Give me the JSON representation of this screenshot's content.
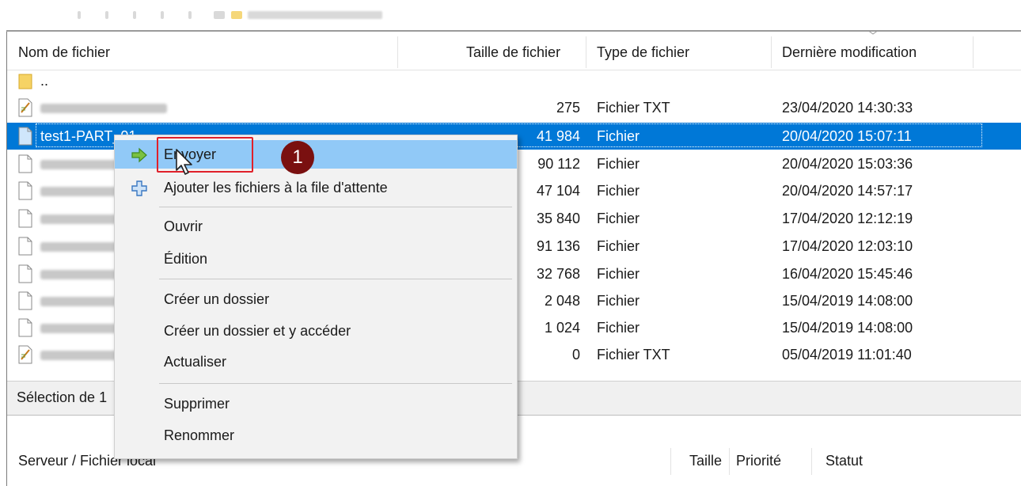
{
  "file_list": {
    "columns": [
      "Nom de fichier",
      "Taille de fichier",
      "Type de fichier",
      "Dernière modification"
    ],
    "rows": [
      {
        "name": "..",
        "size": "",
        "type": "",
        "date": "",
        "icon": "folder-icon"
      },
      {
        "name": "",
        "size": "275",
        "type": "Fichier TXT",
        "date": "23/04/2020 14:30:33",
        "icon": "text-file-icon"
      },
      {
        "name": "test1-PART_01",
        "size": "41 984",
        "type": "Fichier",
        "date": "20/04/2020 15:07:11",
        "icon": "file-icon",
        "selected": true
      },
      {
        "name": "",
        "size": "90 112",
        "type": "Fichier",
        "date": "20/04/2020 15:03:36",
        "icon": "file-icon"
      },
      {
        "name": "",
        "size": "47 104",
        "type": "Fichier",
        "date": "20/04/2020 14:57:17",
        "icon": "file-icon"
      },
      {
        "name": "",
        "size": "35 840",
        "type": "Fichier",
        "date": "17/04/2020 12:12:19",
        "icon": "file-icon"
      },
      {
        "name": "",
        "size": "91 136",
        "type": "Fichier",
        "date": "17/04/2020 12:03:10",
        "icon": "file-icon"
      },
      {
        "name": "",
        "size": "32 768",
        "type": "Fichier",
        "date": "16/04/2020 15:45:46",
        "icon": "file-icon"
      },
      {
        "name": "",
        "size": "2 048",
        "type": "Fichier",
        "date": "15/04/2019 14:08:00",
        "icon": "file-icon"
      },
      {
        "name": "",
        "size": "1 024",
        "type": "Fichier",
        "date": "15/04/2019 14:08:00",
        "icon": "file-icon"
      },
      {
        "name": "",
        "size": "0",
        "type": "Fichier TXT",
        "date": "05/04/2019 11:01:40",
        "icon": "text-file-icon"
      }
    ]
  },
  "status": {
    "text": "Sélection de 1"
  },
  "queue": {
    "columns": [
      "Serveur / Fichier local",
      "Taille",
      "Priorité",
      "Statut"
    ]
  },
  "context_menu": {
    "items": [
      {
        "label": "Envoyer",
        "icon": "upload-arrow-icon",
        "highlighted": true
      },
      {
        "label": "Ajouter les fichiers à la file d'attente",
        "icon": "add-queue-icon"
      },
      {
        "label": "Ouvrir"
      },
      {
        "label": "Édition"
      },
      {
        "label": "Créer un dossier"
      },
      {
        "label": "Créer un dossier et y accéder"
      },
      {
        "label": "Actualiser"
      },
      {
        "label": "Supprimer"
      },
      {
        "label": "Renommer"
      }
    ]
  },
  "annotation": {
    "step": "1"
  },
  "colors": {
    "selection": "#0078d7",
    "menu_highlight": "#91c9f7",
    "annotation_box": "#e0202a",
    "badge": "#7a1010"
  }
}
